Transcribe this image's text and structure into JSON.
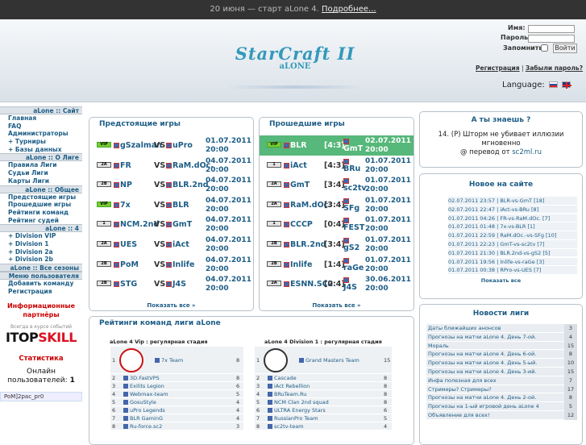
{
  "banner": {
    "text": "20 июня — старт aLone 4.",
    "link": "Подробнее..."
  },
  "logo": {
    "line1": "StarCraft II",
    "line2": "aLONE"
  },
  "login": {
    "name_label": "Имя:",
    "password_label": "Пароль:",
    "remember_label": "Запомнить:",
    "button": "Войти"
  },
  "links": {
    "register": "Регистрация",
    "forgot": "Забыли пароль?",
    "separator": "|"
  },
  "language": {
    "label": "Language:"
  },
  "sidebar": {
    "sections": [
      {
        "title": "aLone :: Сайт",
        "items": [
          "Главная",
          "FAQ",
          "Администраторы",
          "+ Турниры",
          "+ Базы данных"
        ]
      },
      {
        "title": "aLone :: О Лиге",
        "items": [
          "Правила Лиги",
          "Судьи Лиги",
          "Карты Лиги"
        ]
      },
      {
        "title": "aLone :: Общее",
        "items": [
          "Предстоящие игры",
          "Прошедшие игры",
          "Рейтинги команд",
          "Рейтинг судей"
        ]
      },
      {
        "title": "aLone :: 4",
        "items": [
          "+ Division VIP",
          "+ Division 1",
          "+ Division 2a",
          "+ Division 2b"
        ]
      },
      {
        "title": "aLone :: Все сезоны",
        "items": []
      },
      {
        "title": "Меню пользователя",
        "items": [
          "Добавить команду",
          "Регистрация"
        ]
      }
    ],
    "partners": "Информационные партнёры",
    "itop_tag": "Всегда в курсе событий",
    "itop_name_1": "ITOP",
    "itop_name_2": "SKILL",
    "stats_title": "Статистика",
    "stats_label": "Онлайн пользователей:",
    "stats_value": "1",
    "online_user": "PoM]2pac_pr0"
  },
  "upcoming": {
    "title": "Предстоящие игры",
    "show_all": "Показать все »",
    "matches": [
      {
        "badge": "VIP",
        "t1": "gSzalman",
        "vs": "VS",
        "t2": "uPro",
        "date": "01.07.2011",
        "time": "20:00"
      },
      {
        "badge": "2A",
        "t1": "FR",
        "vs": "VS",
        "t2": "RaM.dOc.",
        "date": "04.07.2011",
        "time": "20:00"
      },
      {
        "badge": "2B",
        "t1": "NP",
        "vs": "VS",
        "t2": "BLR.2nd",
        "date": "04.07.2011",
        "time": "20:00"
      },
      {
        "badge": "VIP",
        "t1": "7x",
        "vs": "VS",
        "t2": "BLR",
        "date": "04.07.2011",
        "time": "20:00"
      },
      {
        "badge": "1",
        "t1": "NCM.2nd",
        "vs": "VS",
        "t2": "GmT",
        "date": "04.07.2011",
        "time": "20:00"
      },
      {
        "badge": "2A",
        "t1": "UES",
        "vs": "VS",
        "t2": "iAct",
        "date": "04.07.2011",
        "time": "20:00"
      },
      {
        "badge": "2B",
        "t1": "PoM",
        "vs": "VS",
        "t2": "Inlife",
        "date": "04.07.2011",
        "time": "20:00"
      },
      {
        "badge": "2B",
        "t1": "STG",
        "vs": "VS",
        "t2": "J4S",
        "date": "04.07.2011",
        "time": "20:00"
      }
    ]
  },
  "past": {
    "title": "Прошедшие игры",
    "show_all": "Показать все »",
    "matches": [
      {
        "badge": "VIP",
        "t1": "BLR",
        "score": "[4:3]",
        "t2": "GmT",
        "date": "02.07.2011",
        "time": "20:00"
      },
      {
        "badge": "1",
        "t1": "iAct",
        "score": "[4:3]",
        "t2": "BRu",
        "date": "01.07.2011",
        "time": "20:00"
      },
      {
        "badge": "2A",
        "t1": "GmT",
        "score": "[3:4]",
        "t2": "sc2tv",
        "date": "01.07.2011",
        "time": "20:00"
      },
      {
        "badge": "2A",
        "t1": "RaM.dOc.",
        "score": "[3:4]",
        "t2": "SFg",
        "date": "01.07.2011",
        "time": "20:00"
      },
      {
        "badge": "1",
        "t1": "CCCP",
        "score": "[0:4]",
        "t2": "FEST",
        "date": "01.07.2011",
        "time": "20:00"
      },
      {
        "badge": "2B",
        "t1": "BLR.2nd",
        "score": "[3:4]",
        "t2": "gS2",
        "date": "01.07.2011",
        "time": "20:00"
      },
      {
        "badge": "2B",
        "t1": "Inlife",
        "score": "[1:4]",
        "t2": "raGe",
        "date": "01.07.2011",
        "time": "20:00"
      },
      {
        "badge": "2A",
        "t1": "ESNN.SC2",
        "score": "[0:4]",
        "t2": "J4S",
        "date": "30.06.2011",
        "time": "20:00"
      }
    ]
  },
  "ratings": {
    "title": "Рейтинги команд лиги aLone",
    "left": {
      "title": "aLone 4 Vip : регулярная стадия",
      "rows": [
        {
          "n": "1",
          "name": "7x Team",
          "p": "8"
        },
        {
          "n": "2",
          "name": "3D.FastVPS",
          "p": "8"
        },
        {
          "n": "3",
          "name": "Exilits Legion",
          "p": "6"
        },
        {
          "n": "4",
          "name": "Webmax-team",
          "p": "5"
        },
        {
          "n": "5",
          "name": "GosuStyle",
          "p": "4"
        },
        {
          "n": "6",
          "name": "uPro Legends",
          "p": "4"
        },
        {
          "n": "7",
          "name": "BLR GaminG",
          "p": "4"
        },
        {
          "n": "8",
          "name": "Ru-force.sc2",
          "p": "3"
        }
      ]
    },
    "right": {
      "title": "aLone 4 Division 1 : регулярная стадия",
      "rows": [
        {
          "n": "1",
          "name": "Grand Masters Team",
          "p": "15"
        },
        {
          "n": "2",
          "name": "Cascade",
          "p": "8"
        },
        {
          "n": "3",
          "name": "iAct Rebellion",
          "p": "8"
        },
        {
          "n": "4",
          "name": "BRuTeam.Ru",
          "p": "8"
        },
        {
          "n": "5",
          "name": "NCM Clan 2nd squad",
          "p": "8"
        },
        {
          "n": "6",
          "name": "ULTRA Energy Stars",
          "p": "6"
        },
        {
          "n": "7",
          "name": "RussianPro Team",
          "p": "5"
        },
        {
          "n": "8",
          "name": "sc2tv-team",
          "p": "4"
        }
      ]
    }
  },
  "did_you_know": {
    "title": "А ты знаешь ?",
    "text": "14. (P) Шторм не убивает иллюзии мгновенно",
    "credit_prefix": "@ перевод от ",
    "credit_link": "sc2ml.ru"
  },
  "site_news": {
    "title": "Новое на сайте",
    "show_all": "Показать все",
    "rows": [
      "02.07.2011 23:57 | BLR-vs-GmT [18]",
      "02.07.2011 22:47 | iAct-vs-BRu [8]",
      "01.07.2011 04:26 | FR-vs-RaM.dOc. [7]",
      "01.07.2011 01:48 | 7x-vs-BLR [1]",
      "01.07.2011 22:59 | RaM.dOc.-vs-SFg [10]",
      "01.07.2011 22:23 | GmT-vs-sc2tv [7]",
      "01.07.2011 21:30 | BLR.2nd-vs-gS2 [5]",
      "01.07.2011 19:56 | Inlife-vs-raGe [3]",
      "01.07.2011 00:38 | RPro-vs-UES [7]"
    ]
  },
  "league_news": {
    "title": "Новости лиги",
    "rows": [
      {
        "t": "Даты ближайших анонсов",
        "c": "3"
      },
      {
        "t": "Прогнозы на матчи aLone 4. День 7-ой.",
        "c": "4"
      },
      {
        "t": "Мораль",
        "c": "15"
      },
      {
        "t": "Прогнозы на матчи aLone 4. День 6-ой.",
        "c": "8"
      },
      {
        "t": "Прогнозы на матчи aLone 4. День 5-ый.",
        "c": "10"
      },
      {
        "t": "Прогнозы на матчи aLone 4. День 3-ий.",
        "c": "15"
      },
      {
        "t": "Инфа полезная для всех",
        "c": "7"
      },
      {
        "t": "Стримеры? Стримеры?",
        "c": "17"
      },
      {
        "t": "Прогнозы на матчи aLone 4. День 2-ой.",
        "c": "8"
      },
      {
        "t": "Прогнозы на 1-ый игровой день aLone 4",
        "c": "5"
      },
      {
        "t": "Объявление для всех!",
        "c": "12"
      }
    ]
  },
  "colors": {
    "accent": "#1d5d86",
    "highlight": "#56b87a",
    "partners": "#cc0000"
  }
}
